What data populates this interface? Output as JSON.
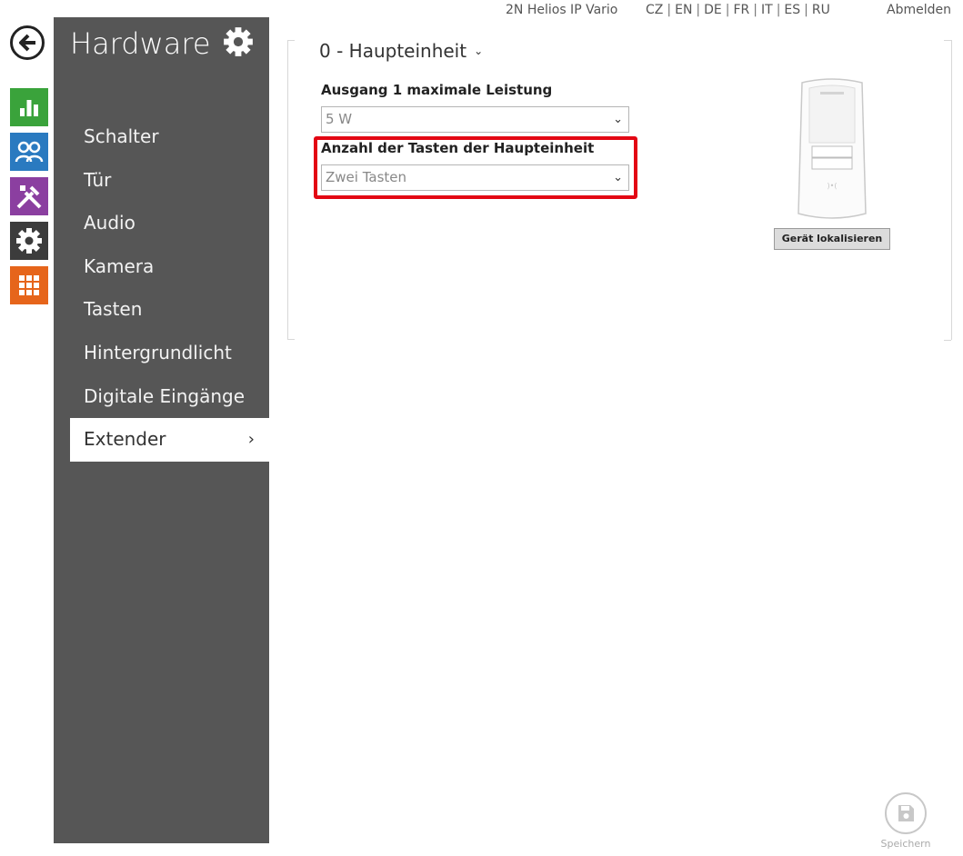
{
  "topbar": {
    "device_name": "2N Helios IP Vario",
    "languages": [
      "CZ",
      "EN",
      "DE",
      "FR",
      "IT",
      "ES",
      "RU"
    ],
    "logout_label": "Abmelden"
  },
  "rail": {
    "icons": [
      "back-icon",
      "chart-icon",
      "users-icon",
      "tools-icon",
      "gear-icon",
      "grid-icon"
    ],
    "colors": {
      "status": "#3aa33b",
      "users": "#2a7ac0",
      "services": "#8b3fa0",
      "hardware": "#3c3c3c",
      "system": "#e6651b"
    }
  },
  "sidebar": {
    "title": "Hardware",
    "items": [
      {
        "label": "Schalter"
      },
      {
        "label": "Tür"
      },
      {
        "label": "Audio"
      },
      {
        "label": "Kamera"
      },
      {
        "label": "Tasten"
      },
      {
        "label": "Hintergrundlicht"
      },
      {
        "label": "Digitale Eingänge"
      },
      {
        "label": "Extender",
        "active": true
      }
    ]
  },
  "main": {
    "unit_title": "0 - Haupteinheit",
    "fields": [
      {
        "label": "Ausgang 1 maximale Leistung",
        "value": "5 W"
      },
      {
        "label": "Anzahl der Tasten der Haupteinheit",
        "value": "Zwei Tasten"
      }
    ],
    "highlight_color": "#e30613",
    "locate_button": "Gerät lokalisieren"
  },
  "footer": {
    "save_label": "Speichern"
  }
}
